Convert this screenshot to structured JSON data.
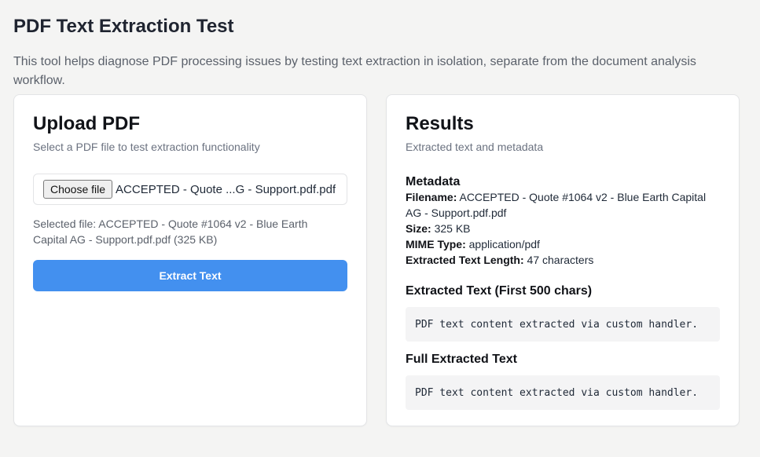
{
  "page": {
    "title": "PDF Text Extraction Test",
    "description": "This tool helps diagnose PDF processing issues by testing text extraction in isolation, separate from the document analysis workflow."
  },
  "upload": {
    "title": "Upload PDF",
    "subtitle": "Select a PDF file to test extraction functionality",
    "choose_label": "Choose file",
    "file_display": "ACCEPTED - Quote ...G - Support.pdf.pdf",
    "selected_text": "Selected file: ACCEPTED - Quote #1064 v2 - Blue Earth Capital AG - Support.pdf.pdf (325 KB)",
    "extract_label": "Extract Text",
    "accent_color": "#4390ef"
  },
  "results": {
    "title": "Results",
    "subtitle": "Extracted text and metadata",
    "metadata_heading": "Metadata",
    "metadata": [
      {
        "label": "Filename:",
        "value": "ACCEPTED - Quote #1064 v2 - Blue Earth Capital AG - Support.pdf.pdf"
      },
      {
        "label": "Size:",
        "value": "325 KB"
      },
      {
        "label": "MIME Type:",
        "value": "application/pdf"
      },
      {
        "label": "Extracted Text Length:",
        "value": "47 characters"
      }
    ],
    "preview_heading": "Extracted Text (First 500 chars)",
    "preview_text": "PDF text content extracted via custom handler.",
    "full_heading": "Full Extracted Text",
    "full_text": "PDF text content extracted via custom handler."
  }
}
